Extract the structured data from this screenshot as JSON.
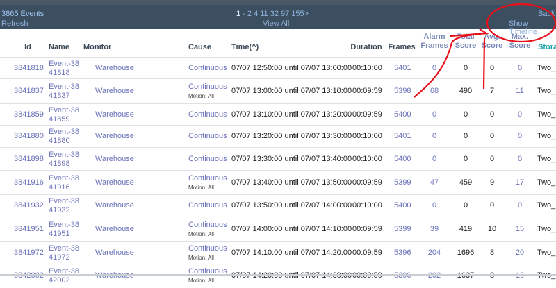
{
  "header": {
    "event_count": "3865 Events",
    "refresh": "Refresh",
    "pager_prefix": "-",
    "current_page": "1",
    "pages": "- 2 4 11 32 97 155>",
    "view_all": "View All",
    "back": "Back",
    "show_timeline": "Show Timeline"
  },
  "columns": {
    "id": "Id",
    "name": "Name",
    "monitor": "Monitor",
    "cause": "Cause",
    "time": "Time(^)",
    "duration": "Duration",
    "frames": "Frames",
    "alarm_frames": "Alarm Frames",
    "total_score": "Total Score",
    "avg_score": "Avg. Score",
    "max_score": "Max. Score",
    "storage": "Stora"
  },
  "rows": [
    {
      "id": "3841818",
      "name": "Event-3841818",
      "monitor": "Warehouse",
      "cause": "Continuous",
      "cause_sub": "",
      "time": "07/07 12:50:00 until 07/07 13:00:00",
      "duration": "00:10:00",
      "frames": "5401",
      "alarm": "0",
      "total": "0",
      "avg": "0",
      "max": "0",
      "storage": "Two_"
    },
    {
      "id": "3841837",
      "name": "Event-3841837",
      "monitor": "Warehouse",
      "cause": "Continuous",
      "cause_sub": "Motion: All",
      "time": "07/07 13:00:00 until 07/07 13:10:00",
      "duration": "00:09:59",
      "frames": "5398",
      "alarm": "68",
      "total": "490",
      "avg": "7",
      "max": "11",
      "storage": "Two_"
    },
    {
      "id": "3841859",
      "name": "Event-3841859",
      "monitor": "Warehouse",
      "cause": "Continuous",
      "cause_sub": "",
      "time": "07/07 13:10:00 until 07/07 13:20:00",
      "duration": "00:09:59",
      "frames": "5400",
      "alarm": "0",
      "total": "0",
      "avg": "0",
      "max": "0",
      "storage": "Two_"
    },
    {
      "id": "3841880",
      "name": "Event-3841880",
      "monitor": "Warehouse",
      "cause": "Continuous",
      "cause_sub": "",
      "time": "07/07 13:20:00 until 07/07 13:30:00",
      "duration": "00:10:00",
      "frames": "5401",
      "alarm": "0",
      "total": "0",
      "avg": "0",
      "max": "0",
      "storage": "Two_"
    },
    {
      "id": "3841898",
      "name": "Event-3841898",
      "monitor": "Warehouse",
      "cause": "Continuous",
      "cause_sub": "",
      "time": "07/07 13:30:00 until 07/07 13:40:00",
      "duration": "00:10:00",
      "frames": "5400",
      "alarm": "0",
      "total": "0",
      "avg": "0",
      "max": "0",
      "storage": "Two_"
    },
    {
      "id": "3841916",
      "name": "Event-3841916",
      "monitor": "Warehouse",
      "cause": "Continuous",
      "cause_sub": "Motion: All",
      "time": "07/07 13:40:00 until 07/07 13:50:00",
      "duration": "00:09:59",
      "frames": "5399",
      "alarm": "47",
      "total": "459",
      "avg": "9",
      "max": "17",
      "storage": "Two_"
    },
    {
      "id": "3841932",
      "name": "Event-3841932",
      "monitor": "Warehouse",
      "cause": "Continuous",
      "cause_sub": "",
      "time": "07/07 13:50:00 until 07/07 14:00:00",
      "duration": "00:10:00",
      "frames": "5400",
      "alarm": "0",
      "total": "0",
      "avg": "0",
      "max": "0",
      "storage": "Two_"
    },
    {
      "id": "3841951",
      "name": "Event-3841951",
      "monitor": "Warehouse",
      "cause": "Continuous",
      "cause_sub": "Motion: All",
      "time": "07/07 14:00:00 until 07/07 14:10:00",
      "duration": "00:09:59",
      "frames": "5399",
      "alarm": "39",
      "total": "419",
      "avg": "10",
      "max": "15",
      "storage": "Two_"
    },
    {
      "id": "3841972",
      "name": "Event-3841972",
      "monitor": "Warehouse",
      "cause": "Continuous",
      "cause_sub": "Motion: All",
      "time": "07/07 14:10:00 until 07/07 14:20:00",
      "duration": "00:09:59",
      "frames": "5396",
      "alarm": "204",
      "total": "1696",
      "avg": "8",
      "max": "20",
      "storage": "Two_"
    },
    {
      "id": "3842002",
      "name": "Event-3842002",
      "monitor": "Warehouse",
      "cause": "Continuous",
      "cause_sub": "Motion: All",
      "time": "07/07 14:20:00 until 07/07 14:30:00",
      "duration": "00:09:59",
      "frames": "5396",
      "alarm": "202",
      "total": "1637",
      "avg": "8",
      "max": "16",
      "storage": "Two_"
    }
  ],
  "colors": {
    "header_bg": "#3c4f60",
    "link": "#6a72b8",
    "storage_header": "#19a4a8",
    "annotation": "#e8101a"
  }
}
